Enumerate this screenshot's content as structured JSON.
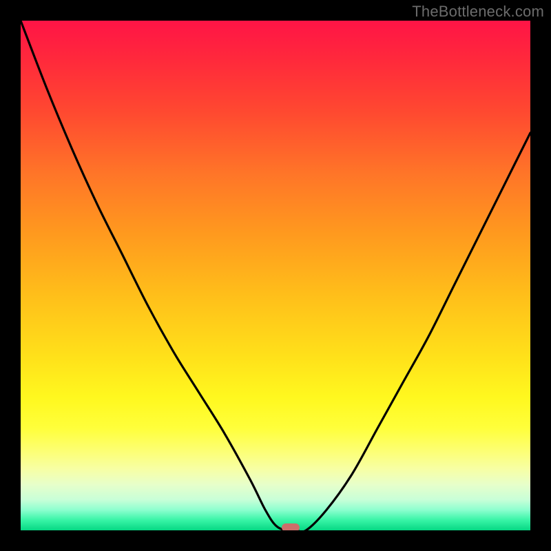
{
  "watermark": "TheBottleneck.com",
  "chart_data": {
    "type": "line",
    "title": "",
    "xlabel": "",
    "ylabel": "",
    "xlim": [
      0,
      100
    ],
    "ylim": [
      0,
      100
    ],
    "grid": false,
    "legend": false,
    "series": [
      {
        "name": "curve",
        "x": [
          0,
          5,
          10,
          15,
          20,
          25,
          30,
          35,
          40,
          45,
          48,
          50,
          52,
          54,
          56,
          60,
          65,
          70,
          75,
          80,
          85,
          90,
          95,
          100
        ],
        "y": [
          100,
          87,
          75,
          64,
          54,
          44,
          35,
          27,
          19,
          10,
          4,
          1,
          0,
          0,
          0,
          4,
          11,
          20,
          29,
          38,
          48,
          58,
          68,
          78
        ]
      }
    ],
    "marker": {
      "x": 53,
      "y": 0.5
    },
    "background": "red-yellow-green vertical gradient",
    "colors": {
      "curve": "#000000",
      "marker": "#cc6e6a"
    }
  }
}
